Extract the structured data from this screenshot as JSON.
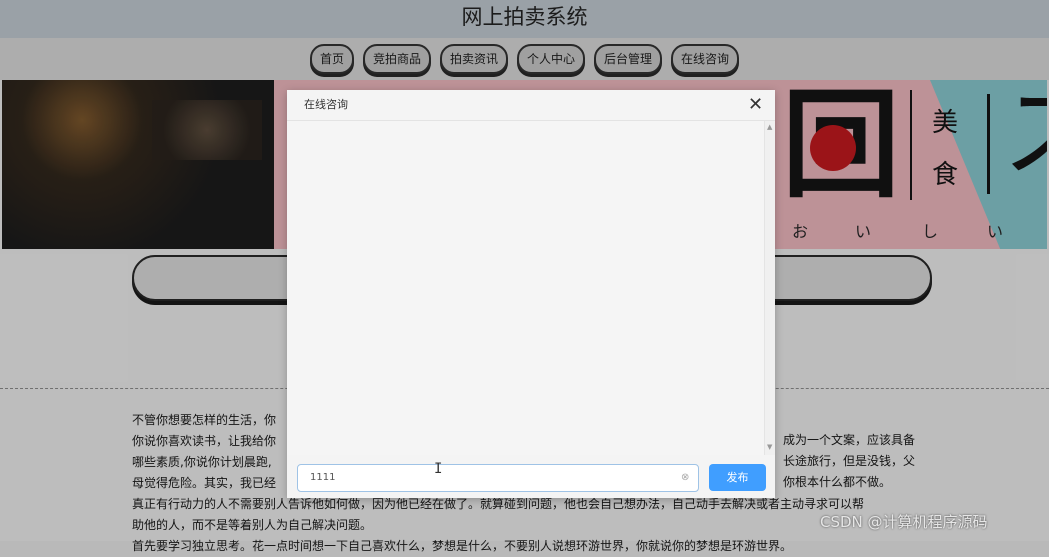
{
  "header": {
    "title": "网上拍卖系统"
  },
  "nav": {
    "items": [
      {
        "label": "首页"
      },
      {
        "label": "竞拍商品"
      },
      {
        "label": "拍卖资讯"
      },
      {
        "label": "个人中心"
      },
      {
        "label": "后台管理"
      },
      {
        "label": "在线咨询"
      }
    ]
  },
  "banner": {
    "main_char": "回",
    "side_chars": [
      "美",
      "食"
    ],
    "right_char": "ス",
    "roman": [
      "お",
      "い",
      "し",
      "い"
    ]
  },
  "article": {
    "lines": [
      "不管你想要怎样的生活，你",
      "你说你喜欢读书，让我给你",
      "哪些素质,你说你计划晨跑,",
      "母觉得危险。其实，我已经",
      "真正有行动力的人不需要别人告诉他如何做，因为他已经在做了。就算碰到问题，他也会自己想办法，自己动手去解决或者主动寻求可以帮",
      "助他的人，而不是等着别人为自己解决问题。",
      "首先要学习独立思考。花一点时间想一下自己喜欢什么，梦想是什么，不要别人说想环游世界，你就说你的梦想是环游世界。"
    ],
    "right_fragments": [
      "成为一个文案，应该具备",
      "长途旅行，但是没钱，父",
      "你根本什么都不做。"
    ]
  },
  "dialog": {
    "title": "在线咨询",
    "close_icon": "close-icon",
    "input_value": "1111",
    "publish_label": "发布"
  },
  "watermark": "CSDN @计算机程序源码",
  "colors": {
    "primary": "#409eff",
    "header_bg": "#a3aab0"
  }
}
